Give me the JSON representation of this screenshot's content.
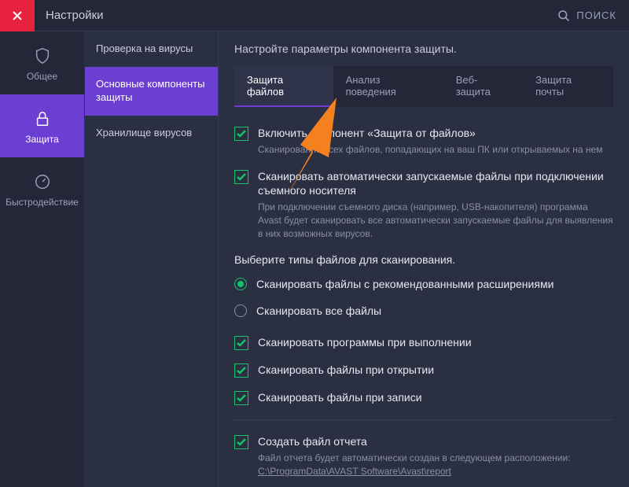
{
  "topbar": {
    "title": "Настройки",
    "search": "поиск"
  },
  "sidebar": {
    "items": [
      {
        "label": "Общее"
      },
      {
        "label": "Защита"
      },
      {
        "label": "Быстродействие"
      }
    ]
  },
  "subnav": {
    "items": [
      {
        "label": "Проверка на вирусы"
      },
      {
        "label": "Основные компоненты защиты"
      },
      {
        "label": "Хранилище вирусов"
      }
    ]
  },
  "content": {
    "intro": "Настройте параметры компонента защиты.",
    "tabs": [
      {
        "label": "Защита файлов"
      },
      {
        "label": "Анализ поведения"
      },
      {
        "label": "Веб-защита"
      },
      {
        "label": "Защита почты"
      }
    ],
    "opt1": {
      "label": "Включить компонент «Защита от файлов»",
      "desc": "Сканирование всех файлов, попадающих на ваш ПК или открываемых на нем"
    },
    "opt2": {
      "label": "Сканировать автоматически запускаемые файлы при подключении съемного носителя",
      "desc": "При подключении съемного диска (например, USB-накопителя) программа Avast будет сканировать все автоматически запускаемые файлы для выявления в них возможных вирусов."
    },
    "scanTypesHead": "Выберите типы файлов для сканирования.",
    "radio1": "Сканировать файлы с рекомендованными расширениями",
    "radio2": "Сканировать все файлы",
    "opt3": "Сканировать программы при выполнении",
    "opt4": "Сканировать файлы при открытии",
    "opt5": "Сканировать файлы при записи",
    "report": {
      "label": "Создать файл отчета",
      "desc": "Файл отчета будет автоматически создан в следующем расположении:",
      "path": "C:\\ProgramData\\AVAST Software\\Avast\\report"
    }
  }
}
